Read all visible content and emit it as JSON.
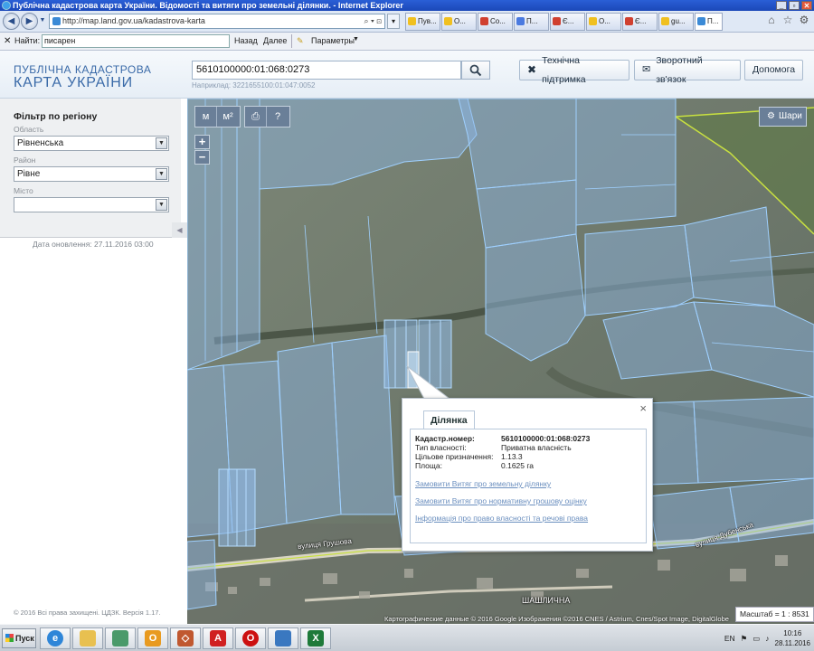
{
  "browser": {
    "title": "Публічна кадастрова карта України. Відомості та витяги про земельні ділянки. - Internet Explorer",
    "address": "http://map.land.gov.ua/kadastrova-karta",
    "tabs": [
      {
        "label": "Пув...",
        "color": "#f0c020"
      },
      {
        "label": "О...",
        "color": "#f0c020"
      },
      {
        "label": "Со...",
        "color": "#d04030"
      },
      {
        "label": "П...",
        "color": "#4a7ae0"
      },
      {
        "label": "Є...",
        "color": "#d04030"
      },
      {
        "label": "О...",
        "color": "#f0c020"
      },
      {
        "label": "Є...",
        "color": "#d04030"
      },
      {
        "label": "gu...",
        "color": "#f0c020"
      },
      {
        "label": "П...",
        "color": "#3b8ad6"
      }
    ]
  },
  "findbar": {
    "label": "Найти:",
    "query": "писарен",
    "prev": "Назад",
    "next": "Далее",
    "options": "Параметры"
  },
  "header": {
    "logo_line1": "ПУБЛІЧНА КАДАСТРОВА",
    "logo_line2": "КАРТА УКРАЇНИ",
    "search_value": "5610100000:01:068:0273",
    "search_hint": "Наприклад: 3221655100:01:047:0052",
    "btn_support": "Технічна підтримка",
    "btn_feedback": "Зворотний зв'язок",
    "btn_help": "Допомога"
  },
  "sidebar": {
    "title": "Фільтр по регіону",
    "region_label": "Область",
    "region_value": "Рівненська",
    "district_label": "Район",
    "district_value": "Рівне",
    "city_label": "Місто",
    "city_value": "",
    "updated": "Дата оновлення: 27.11.2016 03:00",
    "copyright": "© 2016 Всі права захищені. ЦДЗК. Версія 1.17."
  },
  "map": {
    "layers_label": "Шари",
    "tools": [
      "м",
      "м²"
    ],
    "streets": [
      "вулиця Грушова",
      "вулиця Дубенська",
      "ШАШЛИЧНА"
    ],
    "attribution": "Картографические данные © 2016 Google Изображения ©2016 CNES / Astrium, Cnes/Spot Image, DigitalGlobe",
    "scale_label": "Масштаб = 1 : 8531"
  },
  "popup": {
    "tab": "Ділянка",
    "rows": [
      {
        "label": "Кадастр.номер:",
        "value": "5610100000:01:068:0273"
      },
      {
        "label": "Тип власності:",
        "value": "Приватна власність"
      },
      {
        "label": "Цільове призначення:",
        "value": "1.13.3"
      },
      {
        "label": "Площа:",
        "value": "0.1625 га"
      }
    ],
    "links": [
      "Замовити Витяг про земельну ділянку",
      "Замовити Витяг про нормативну грошову оцінку",
      "Інформація про право власності та речові права"
    ]
  },
  "taskbar": {
    "start": "Пуск",
    "lang": "EN",
    "time": "10:16",
    "date": "28.11.2016"
  }
}
